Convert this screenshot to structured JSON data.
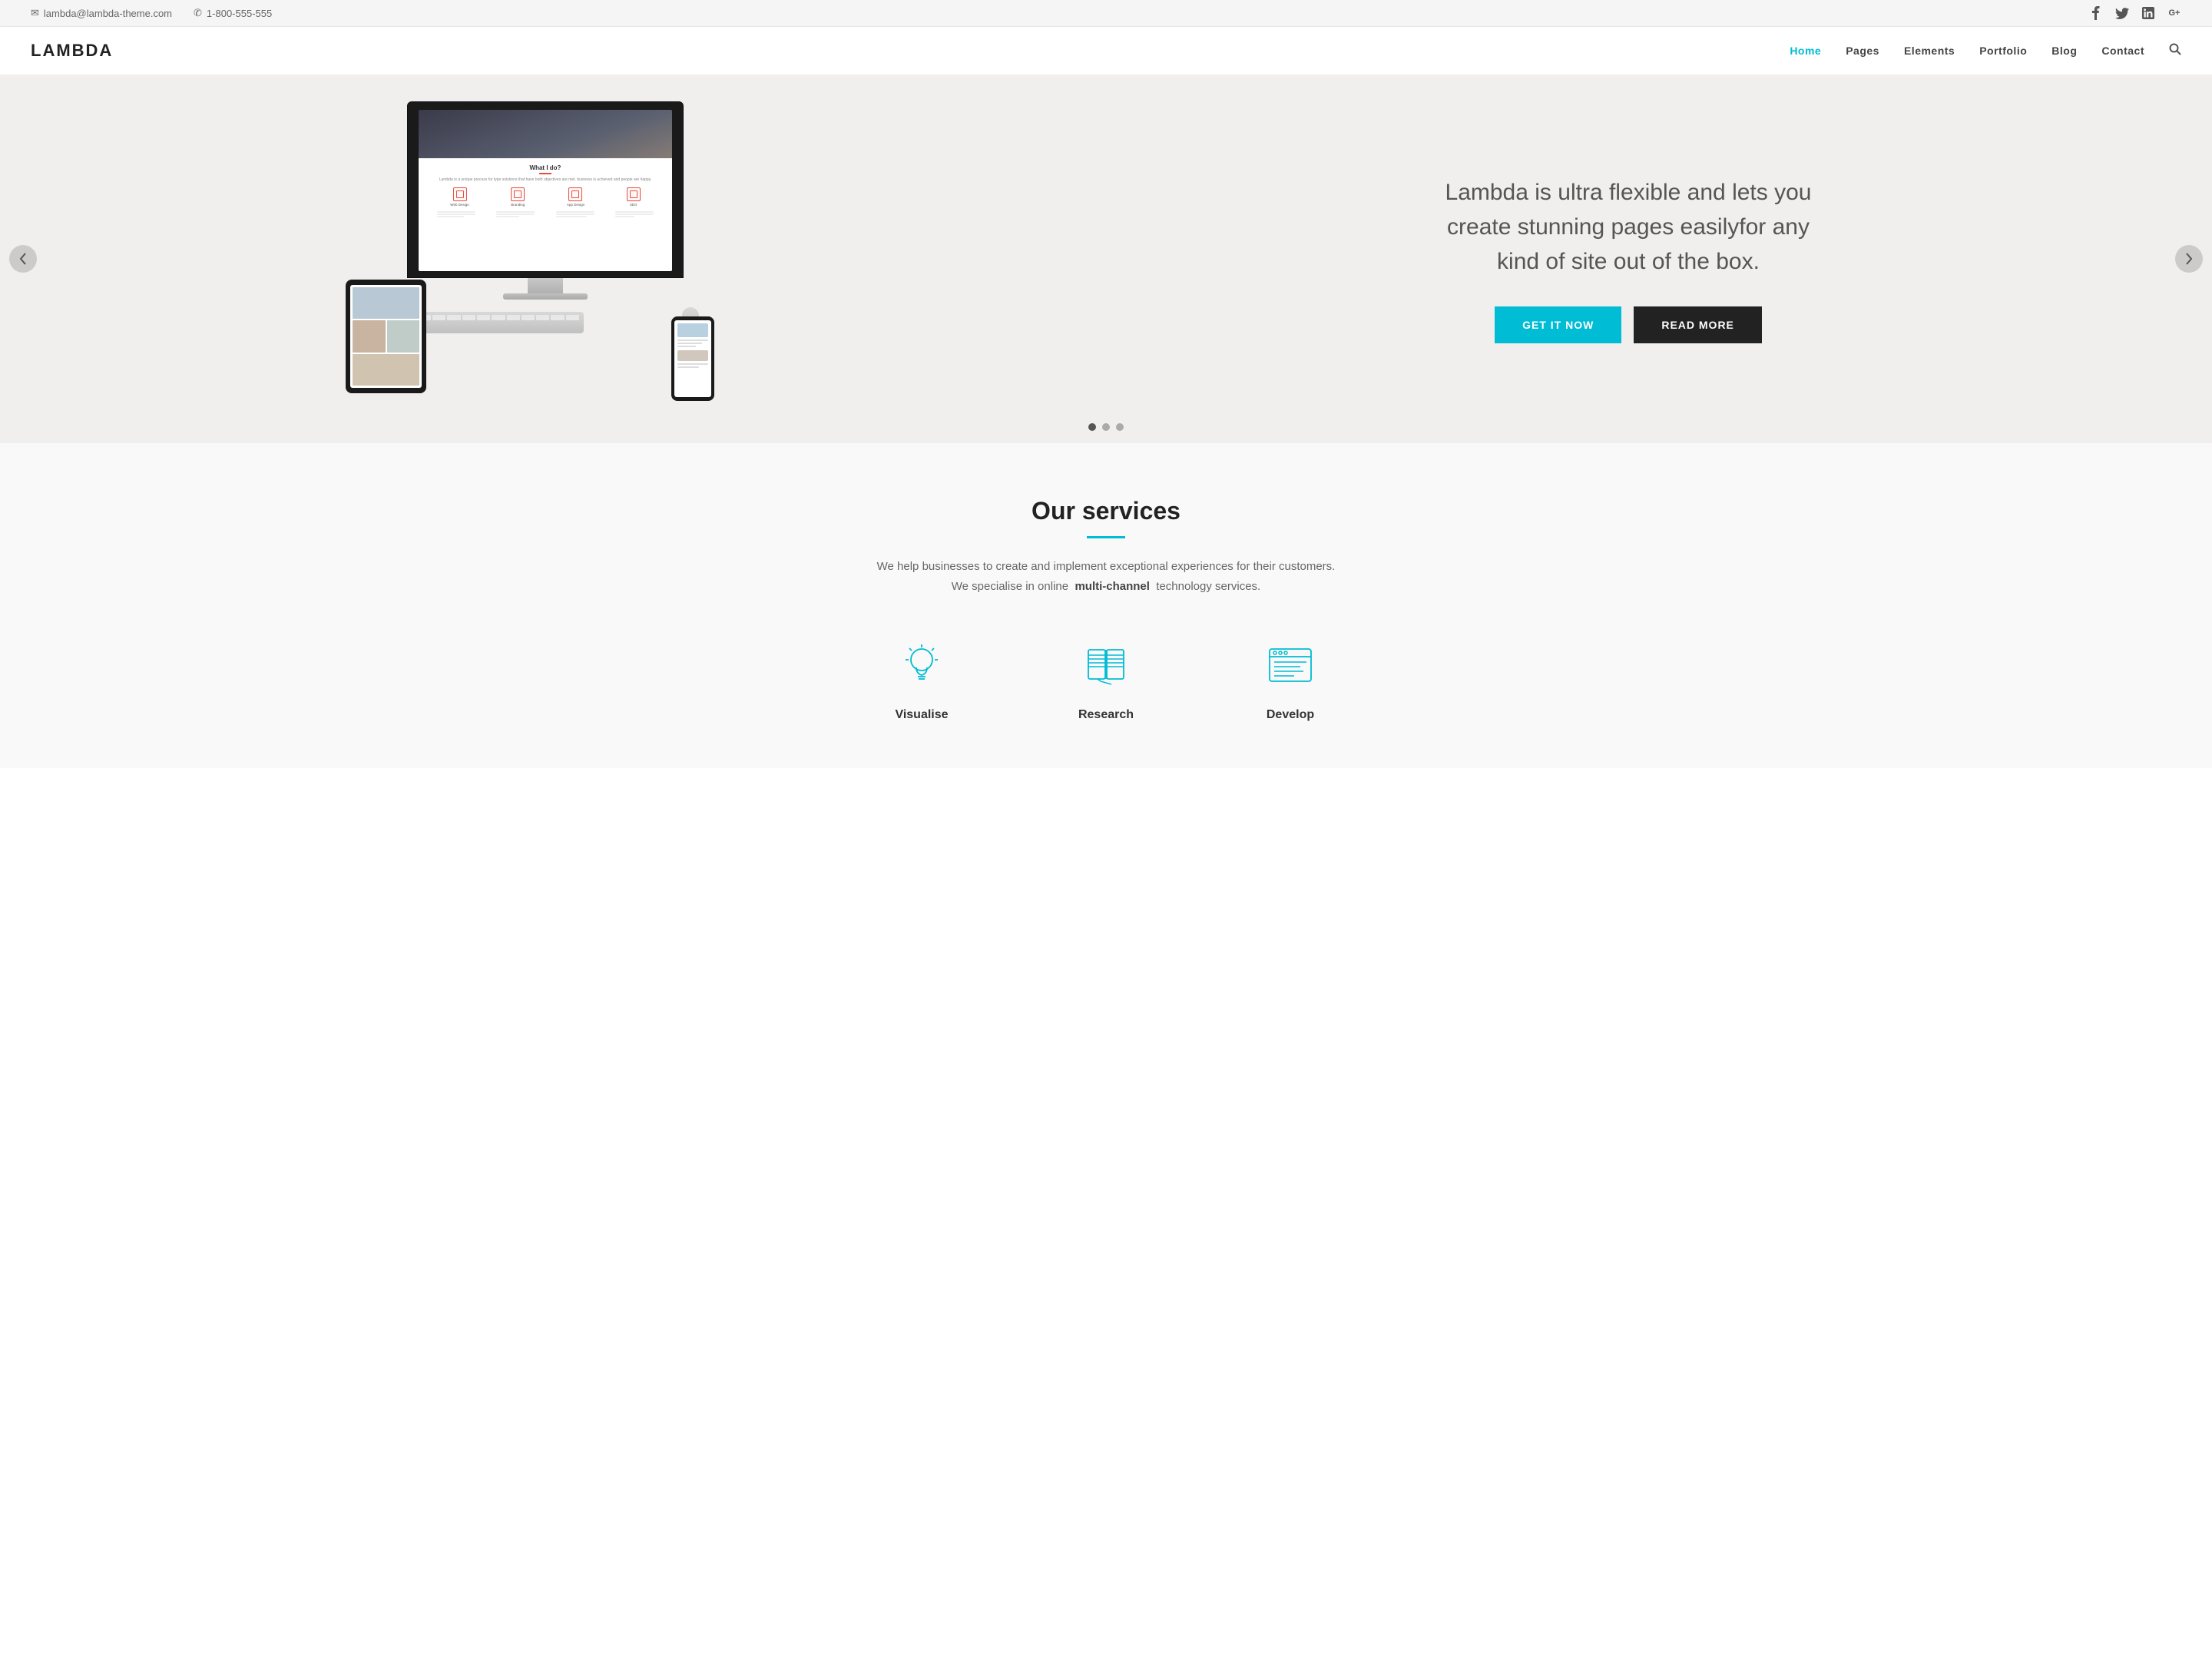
{
  "topbar": {
    "email": "lambda@lambda-theme.com",
    "phone": "1-800-555-555"
  },
  "header": {
    "logo": "LAMBDA",
    "nav": [
      {
        "id": "home",
        "label": "Home",
        "active": true
      },
      {
        "id": "pages",
        "label": "Pages",
        "active": false
      },
      {
        "id": "elements",
        "label": "Elements",
        "active": false
      },
      {
        "id": "portfolio",
        "label": "Portfolio",
        "active": false
      },
      {
        "id": "blog",
        "label": "Blog",
        "active": false
      },
      {
        "id": "contact",
        "label": "Contact",
        "active": false
      }
    ]
  },
  "hero": {
    "tagline": "Lambda is ultra flexible and lets you create stunning pages easilyfor any kind of site out of the box.",
    "btn_primary": "GET IT NOW",
    "btn_secondary": "READ MORE",
    "arrow_left": "‹",
    "arrow_right": "›",
    "dots": [
      {
        "active": true
      },
      {
        "active": false
      },
      {
        "active": false
      }
    ]
  },
  "services": {
    "title": "Our services",
    "subtitle_part1": "We help businesses to create and implement exceptional experiences for their customers.",
    "subtitle_part2": "We specialise in online",
    "subtitle_bold": "multi-channel",
    "subtitle_part3": "technology services.",
    "items": [
      {
        "id": "visualise",
        "label": "Visualise",
        "icon": "lightbulb"
      },
      {
        "id": "research",
        "label": "Research",
        "icon": "book"
      },
      {
        "id": "develop",
        "label": "Develop",
        "icon": "browser"
      }
    ]
  },
  "social": {
    "icons": [
      {
        "id": "facebook",
        "symbol": "f"
      },
      {
        "id": "twitter",
        "symbol": "t"
      },
      {
        "id": "linkedin",
        "symbol": "in"
      },
      {
        "id": "googleplus",
        "symbol": "G+"
      }
    ]
  }
}
